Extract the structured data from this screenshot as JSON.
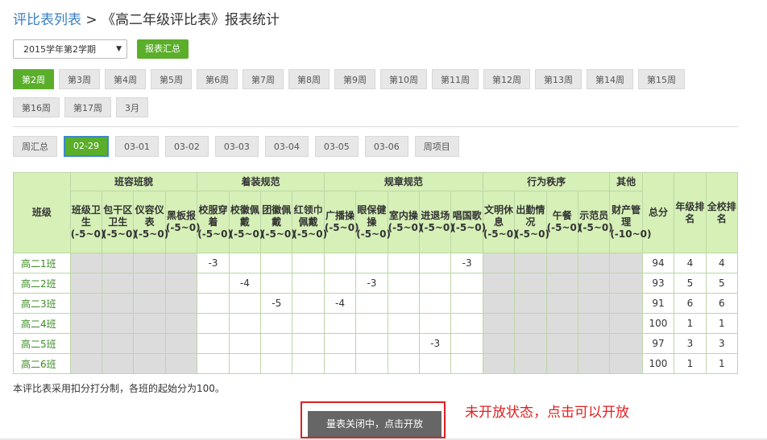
{
  "breadcrumb": {
    "link": "评比表列表",
    "sep": " > ",
    "current": "《高二年级评比表》报表统计"
  },
  "toolbar": {
    "term_value": "2015学年第2学期",
    "summary_button": "报表汇总"
  },
  "weeks": [
    "第2周",
    "第3周",
    "第4周",
    "第5周",
    "第6周",
    "第7周",
    "第8周",
    "第9周",
    "第10周",
    "第11周",
    "第12周",
    "第13周",
    "第14周",
    "第15周",
    "第16周",
    "第17周",
    "3月"
  ],
  "days": [
    "周汇总",
    "02-29",
    "03-01",
    "03-02",
    "03-03",
    "03-04",
    "03-05",
    "03-06",
    "周项目"
  ],
  "table": {
    "class_header": "班级",
    "groups": [
      "班容班貌",
      "着装规范",
      "规章规范",
      "行为秩序",
      "其他"
    ],
    "sub_headers": [
      "班级卫生(-5~0)",
      "包干区卫生(-5~0)",
      "仪容仪表(-5~0)",
      "黑板报(-5~0)",
      "校服穿着(-5~0)",
      "校徽佩戴(-5~0)",
      "团徽佩戴(-5~0)",
      "红领巾佩戴(-5~0)",
      "广播操(-5~0)",
      "眼保健操(-5~0)",
      "室内操(-5~0)",
      "进退场(-5~0)",
      "唱国歌(-5~0)",
      "文明休息(-5~0)",
      "出勤情况(-5~0)",
      "午餐(-5~0)",
      "示范员(-5~0)",
      "财产管理(-10~0)"
    ],
    "total_header": "总分",
    "grade_rank_header": "年级排名",
    "school_rank_header": "全校排名",
    "rows": [
      {
        "name": "高二1班",
        "cells": [
          "",
          "",
          "",
          "",
          "-3",
          "",
          "",
          "",
          "",
          "",
          "",
          "",
          "-3",
          "",
          "",
          "",
          "",
          ""
        ],
        "total": "94",
        "grade_rank": "4",
        "school_rank": "4"
      },
      {
        "name": "高二2班",
        "cells": [
          "",
          "",
          "",
          "",
          "",
          "-4",
          "",
          "",
          "",
          "-3",
          "",
          "",
          "",
          "",
          "",
          "",
          "",
          ""
        ],
        "total": "93",
        "grade_rank": "5",
        "school_rank": "5"
      },
      {
        "name": "高二3班",
        "cells": [
          "",
          "",
          "",
          "",
          "",
          "",
          "-5",
          "",
          "-4",
          "",
          "",
          "",
          "",
          "",
          "",
          "",
          "",
          ""
        ],
        "total": "91",
        "grade_rank": "6",
        "school_rank": "6"
      },
      {
        "name": "高二4班",
        "cells": [
          "",
          "",
          "",
          "",
          "",
          "",
          "",
          "",
          "",
          "",
          "",
          "",
          "",
          "",
          "",
          "",
          "",
          ""
        ],
        "total": "100",
        "grade_rank": "1",
        "school_rank": "1"
      },
      {
        "name": "高二5班",
        "cells": [
          "",
          "",
          "",
          "",
          "",
          "",
          "",
          "",
          "",
          "",
          "",
          "-3",
          "",
          "",
          "",
          "",
          "",
          ""
        ],
        "total": "97",
        "grade_rank": "3",
        "school_rank": "3"
      },
      {
        "name": "高二6班",
        "cells": [
          "",
          "",
          "",
          "",
          "",
          "",
          "",
          "",
          "",
          "",
          "",
          "",
          "",
          "",
          "",
          "",
          "",
          ""
        ],
        "total": "100",
        "grade_rank": "1",
        "school_rank": "1"
      }
    ]
  },
  "note": "本评比表采用扣分打分制，各班的起始分为100。",
  "close_button": "量表关闭中，点击开放",
  "hint": "未开放状态，点击可以开放",
  "colors": {
    "accent": "#5aae2a",
    "header_bg": "#d6f0b8",
    "gray_cell": "#dcdcdc",
    "alert": "#e02020"
  }
}
